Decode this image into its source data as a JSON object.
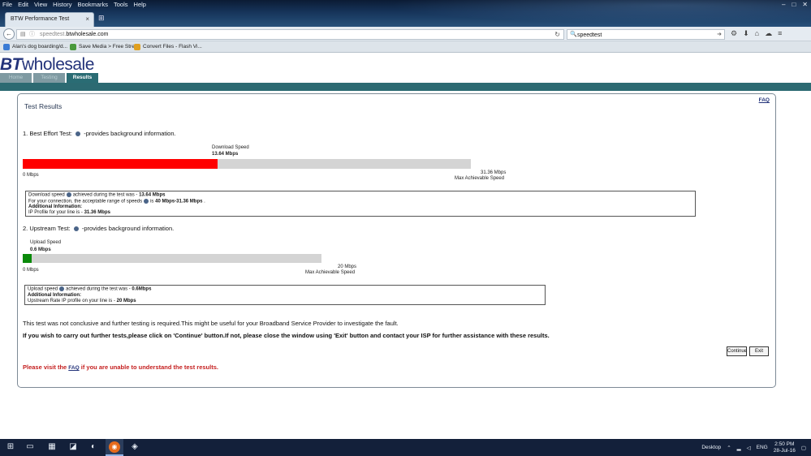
{
  "browser": {
    "menu": [
      "File",
      "Edit",
      "View",
      "History",
      "Bookmarks",
      "Tools",
      "Help"
    ],
    "window_controls": [
      "–",
      "□",
      "✕"
    ],
    "tab_title": "BTW Performance Test",
    "url_host_prefix": "speedtest.",
    "url_domain": "btwholesale.com",
    "search_value": "speedtest",
    "bookmarks": [
      {
        "label": "Alan's dog boarding/d...",
        "color": "#3a7bd5"
      },
      {
        "label": "Save Media > Free Stre...",
        "color": "#4a9a3c"
      },
      {
        "label": "Convert Files - Flash Vi...",
        "color": "#e0a020"
      }
    ]
  },
  "site": {
    "logo_bt": "BT",
    "logo_rest": "wholesale",
    "tabs": [
      "Home",
      "Testing",
      "Results"
    ],
    "active_tab": "Results"
  },
  "results": {
    "title": "Test Results",
    "faq": "FAQ",
    "download": {
      "section_prefix": "1. Best Effort Test:",
      "section_suffix": "-provides background information.",
      "label": "Download Speed",
      "value_text": "13.64 Mbps",
      "min_text": "0 Mbps",
      "max_text": "31.36 Mbps",
      "max_caption": "Max Achievable Speed",
      "fraction": 0.435,
      "color": "#ff0000",
      "info": {
        "line1_a": "Download speed",
        "line1_b": "achieved during the test was -",
        "line1_val": "13.64 Mbps",
        "line2_a": "For your connection, the acceptable range of speeds",
        "line2_b": "is",
        "line2_val": "40 Mbps-31.36 Mbps",
        "line2_end": ".",
        "additional": "Additional Information:",
        "line3_a": "IP Profile for your line is -",
        "line3_val": "31.36 Mbps"
      }
    },
    "upload": {
      "section_prefix": "2. Upstream Test:",
      "section_suffix": "-provides background information.",
      "label": "Upload Speed",
      "value_text": "0.6 Mbps",
      "min_text": "0 Mbps",
      "max_text": "20 Mbps",
      "max_caption": "Max Achievable Speed",
      "fraction": 0.03,
      "color": "#0a8a0a",
      "info": {
        "line1_a": "Upload speed",
        "line1_b": "achieved during the test was -",
        "line1_val": "0.6Mbps",
        "additional": "Additional Information:",
        "line2_a": "Upstream Rate IP profile on your line is -",
        "line2_val": "20 Mbps"
      }
    },
    "message_inconclusive": "This test was not conclusive and further testing is required.This might be useful for your Broadband Service Provider to investigate the fault.",
    "message_instruction": "If you wish to carry out further tests,please click on 'Continue' button.If not, please close the window using 'Exit' button and contact your ISP for further assistance with these results.",
    "continue_label": "Continue",
    "exit_label": "Exit",
    "faq_msg_prefix": "Please visit the",
    "faq_msg_link": "FAQ",
    "faq_msg_suffix": "if you are unable to understand the test results."
  },
  "taskbar": {
    "desktop_label": "Desktop",
    "lang": "ENG",
    "time": "2:50 PM",
    "date": "28-Jul-16"
  }
}
